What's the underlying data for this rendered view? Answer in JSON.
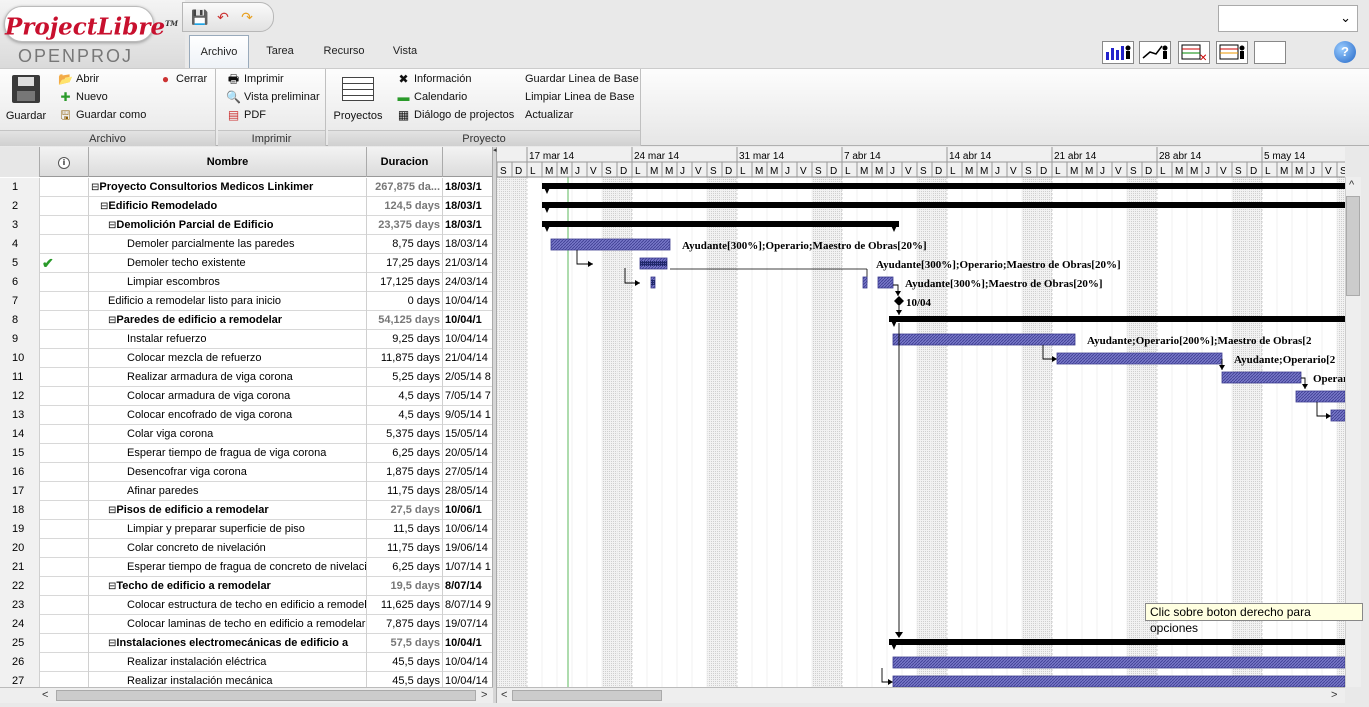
{
  "app": {
    "logo_main": "ProjectLibre",
    "logo_tm": "TM",
    "logo_sub": "OPENPROJ"
  },
  "tabs": [
    {
      "label": "Archivo",
      "active": true
    },
    {
      "label": "Tarea"
    },
    {
      "label": "Recurso"
    },
    {
      "label": "Vista"
    }
  ],
  "ribbon": {
    "archivo": {
      "label": "Archivo",
      "save": "Guardar",
      "open": "Abrir",
      "new": "Nuevo",
      "saveas": "Guardar como",
      "close": "Cerrar"
    },
    "imprimir": {
      "label": "Imprimir",
      "print": "Imprimir",
      "preview": "Vista preliminar",
      "pdf": "PDF"
    },
    "proyecto": {
      "label": "Proyecto",
      "projects": "Proyectos",
      "info": "Información",
      "calendar": "Calendario",
      "dialog": "Diálogo de projectos",
      "save_baseline": "Guardar Linea de Base",
      "clear_baseline": "Limpiar Linea de Base",
      "update": "Actualizar"
    }
  },
  "grid": {
    "headers": {
      "name": "Nombre",
      "duration": "Duracion"
    },
    "rows": [
      {
        "n": "1",
        "name": "Proyecto Consultorios Medicos Linkimer",
        "dur": "267,875 da...",
        "start": "18/03/1",
        "level": 0,
        "summary": true,
        "toggle": "⊟"
      },
      {
        "n": "2",
        "name": "Edificio Remodelado",
        "dur": "124,5 days",
        "start": "18/03/1",
        "level": 1,
        "summary": true,
        "toggle": "⊟"
      },
      {
        "n": "3",
        "name": "Demolición Parcial de Edificio",
        "dur": "23,375 days",
        "start": "18/03/1",
        "level": 2,
        "summary": true,
        "toggle": "⊟"
      },
      {
        "n": "4",
        "name": "Demoler parcialmente las paredes",
        "dur": "8,75 days",
        "start": "18/03/14",
        "level": 3
      },
      {
        "n": "5",
        "name": "Demoler techo existente",
        "dur": "17,25 days",
        "start": "21/03/14",
        "level": 3,
        "check": true
      },
      {
        "n": "6",
        "name": "Limpiar escombros",
        "dur": "17,125 days",
        "start": "24/03/14",
        "level": 3
      },
      {
        "n": "7",
        "name": "Edificio a remodelar listo para inicio",
        "dur": "0 days",
        "start": "10/04/14",
        "level": 2
      },
      {
        "n": "8",
        "name": "Paredes de edificio a remodelar",
        "dur": "54,125 days",
        "start": "10/04/1",
        "level": 2,
        "summary": true,
        "toggle": "⊟"
      },
      {
        "n": "9",
        "name": "Instalar refuerzo",
        "dur": "9,25 days",
        "start": "10/04/14",
        "level": 3
      },
      {
        "n": "10",
        "name": "Colocar mezcla de refuerzo",
        "dur": "11,875 days",
        "start": "21/04/14",
        "level": 3
      },
      {
        "n": "11",
        "name": "Realizar armadura de viga corona",
        "dur": "5,25 days",
        "start": "2/05/14 8",
        "level": 3
      },
      {
        "n": "12",
        "name": "Colocar armadura de viga corona",
        "dur": "4,5 days",
        "start": "7/05/14 7",
        "level": 3
      },
      {
        "n": "13",
        "name": "Colocar encofrado de viga corona",
        "dur": "4,5 days",
        "start": "9/05/14 1",
        "level": 3
      },
      {
        "n": "14",
        "name": "Colar viga corona",
        "dur": "5,375 days",
        "start": "15/05/14",
        "level": 3
      },
      {
        "n": "15",
        "name": "Esperar tiempo de fragua de viga corona",
        "dur": "6,25 days",
        "start": "20/05/14",
        "level": 3
      },
      {
        "n": "16",
        "name": "Desencofrar viga corona",
        "dur": "1,875 days",
        "start": "27/05/14",
        "level": 3
      },
      {
        "n": "17",
        "name": "Afinar paredes",
        "dur": "11,75 days",
        "start": "28/05/14",
        "level": 3
      },
      {
        "n": "18",
        "name": "Pisos de edificio a remodelar",
        "dur": "27,5 days",
        "start": "10/06/1",
        "level": 2,
        "summary": true,
        "toggle": "⊟"
      },
      {
        "n": "19",
        "name": "Limpiar y preparar superficie de piso",
        "dur": "11,5 days",
        "start": "10/06/14",
        "level": 3
      },
      {
        "n": "20",
        "name": "Colar concreto de nivelación",
        "dur": "11,75 days",
        "start": "19/06/14",
        "level": 3
      },
      {
        "n": "21",
        "name": "Esperar tiempo de fragua de concreto de nivelació",
        "dur": "6,25 days",
        "start": "1/07/14 1",
        "level": 3
      },
      {
        "n": "22",
        "name": "Techo de edificio a remodelar",
        "dur": "19,5 days",
        "start": "8/07/14",
        "level": 2,
        "summary": true,
        "toggle": "⊟"
      },
      {
        "n": "23",
        "name": "Colocar estructura de techo en edificio a remodela",
        "dur": "11,625 days",
        "start": "8/07/14 9",
        "level": 3
      },
      {
        "n": "24",
        "name": "Colocar laminas de techo en edificio a remodelar",
        "dur": "7,875 days",
        "start": "19/07/14",
        "level": 3
      },
      {
        "n": "25",
        "name": "Instalaciones electromecánicas de edificio a",
        "dur": "57,5 days",
        "start": "10/04/1",
        "level": 2,
        "summary": true,
        "toggle": "⊟"
      },
      {
        "n": "26",
        "name": "Realizar instalación eléctrica",
        "dur": "45,5 days",
        "start": "10/04/14",
        "level": 3
      },
      {
        "n": "27",
        "name": "Realizar instalación mecánica",
        "dur": "45,5 days",
        "start": "10/04/14",
        "level": 3
      }
    ]
  },
  "gantt": {
    "weeks": [
      "17 mar 14",
      "24 mar 14",
      "31 mar 14",
      "7 abr 14",
      "14 abr 14",
      "21 abr 14",
      "28 abr 14",
      "5 may 14"
    ],
    "day_letters": [
      "S",
      "D",
      "L",
      "M",
      "M",
      "J",
      "V"
    ],
    "last_day_letters": [
      "S",
      "D",
      "L",
      "M",
      "M",
      "J",
      "V",
      "S"
    ],
    "labels": [
      "Ayudante[300%];Operario;Maestro de Obras[20%]",
      "Ayudante[300%];Operario;Maestro de Obras[20%]",
      "Ayudante[300%];Maestro de Obras[20%]",
      "10/04",
      "Ayudante;Operario[200%];Maestro de Obras[2",
      "Ayudante;Operario[2",
      "Operar"
    ]
  },
  "tooltip": "Clic sobre boton derecho para opciones",
  "colors": {
    "task_bar": "#6f6fbf",
    "summary": "#000000",
    "weekend": "#e4e4e4",
    "progress": "#1d2a6e"
  }
}
